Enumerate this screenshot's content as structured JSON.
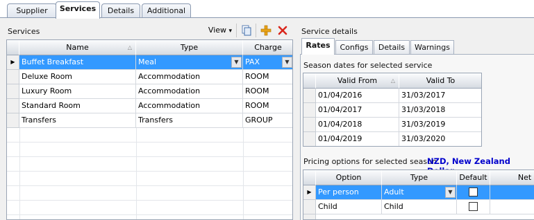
{
  "outer_tabs": [
    "Supplier",
    "Services",
    "Details",
    "Additional"
  ],
  "services_label": "Services",
  "toolbar": {
    "view_label": "View",
    "view_caret": "▾",
    "copy_icon": "copy-icon",
    "add_icon": "add-icon",
    "delete_icon": "delete-icon"
  },
  "services_grid": {
    "columns": [
      "Name",
      "Type",
      "Charge"
    ],
    "rows": [
      [
        "Buffet Breakfast",
        "Meal",
        "PAX"
      ],
      [
        "Deluxe Room",
        "Accommodation",
        "ROOM"
      ],
      [
        "Luxury Room",
        "Accommodation",
        "ROOM"
      ],
      [
        "Standard Room",
        "Accommodation",
        "ROOM"
      ],
      [
        "Transfers",
        "Transfers",
        "GROUP"
      ]
    ],
    "selected_row": 0
  },
  "service_details_label": "Service details",
  "detail_tabs": [
    "Rates",
    "Configs",
    "Details",
    "Warnings"
  ],
  "season_label": "Season dates for selected service",
  "season_grid": {
    "columns": [
      "Valid From",
      "Valid To"
    ],
    "rows": [
      [
        "01/04/2016",
        "31/03/2017"
      ],
      [
        "01/04/2017",
        "31/03/2018"
      ],
      [
        "01/04/2018",
        "31/03/2019"
      ],
      [
        "01/04/2019",
        "31/03/2020"
      ]
    ]
  },
  "pricing_label": "Pricing options for selected season.",
  "currency_label": "NZD, New Zealand Dollar",
  "pricing_grid": {
    "columns": [
      "Option",
      "Type",
      "Default",
      "Net"
    ],
    "rows": [
      {
        "option": "Per person",
        "type": "Adult",
        "default": true
      },
      {
        "option": "Child",
        "type": "Child",
        "default": false
      }
    ]
  },
  "colors": {
    "selection": "#3399ff",
    "currency_text": "#0000cc",
    "delete_icon": "#d9261c",
    "add_icon": "#e8a317"
  }
}
